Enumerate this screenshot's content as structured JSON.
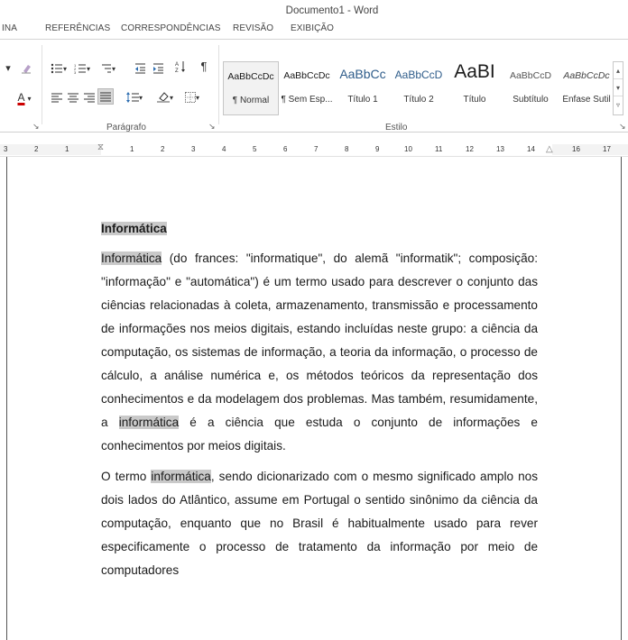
{
  "window": {
    "title": "Documento1 - Word"
  },
  "menu": {
    "tabs": [
      "ΙNA",
      "REFERÊNCIAS",
      "CORRESPONDÊNCIAS",
      "REVISÃO",
      "EXIBIÇÃO"
    ]
  },
  "ribbon": {
    "groups": {
      "paragraph": "Parágrafo",
      "styles": "Estilo"
    },
    "styles": [
      {
        "sample": "AaBbCcDc",
        "name": "¶ Normal",
        "selected": true
      },
      {
        "sample": "AaBbCcDc",
        "name": "¶ Sem Esp...",
        "selected": false
      },
      {
        "sample": "AaBbCc",
        "name": "Título 1",
        "selected": false
      },
      {
        "sample": "AaBbCcD",
        "name": "Título 2",
        "selected": false
      },
      {
        "sample": "AaBI",
        "name": "Título",
        "selected": false
      },
      {
        "sample": "AaBbCcD",
        "name": "Subtítulo",
        "selected": false
      },
      {
        "sample": "AaBbCcDc",
        "name": "Ênfase Sutil",
        "selected": false
      }
    ]
  },
  "ruler": {
    "numbers_left": [
      "3",
      "2",
      "1"
    ],
    "numbers_right": [
      "1",
      "2",
      "3",
      "4",
      "5",
      "6",
      "7",
      "8",
      "9",
      "10",
      "11",
      "12",
      "13",
      "14",
      "16",
      "17"
    ]
  },
  "document": {
    "heading": "Informática",
    "p1": {
      "hl1": "Informática",
      "text1": " (do frances: \"informatique\", do alemã \"informatik\"; composição: \"informação\" e \"automática\") é um termo usado para descrever o conjunto das ciências relacionadas à coleta, armazenamento, transmissão e processamento de informações nos meios digitais, estando incluídas neste grupo: a ciência da computação, os sistemas de informação, a teoria da informação, o processo de cálculo, a análise numérica e, os métodos teóricos da representação dos conhecimentos e da modelagem dos problemas. Mas também, resumidamente, a ",
      "hl2": "informática",
      "text2": " é a ciência que estuda o conjunto de informações e conhecimentos por meios digitais."
    },
    "p2": {
      "text1": "O termo ",
      "hl1": "informática",
      "text2": ", sendo dicionarizado com o mesmo significado amplo nos dois lados do Atlântico, assume em Portugal o sentido sinônimo da ciência da computação, enquanto que no Brasil é habitualmente usado para rever especificamente o processo de tratamento da informação por meio de computadores"
    }
  },
  "colors": {
    "highlight": "#c9c9c9",
    "ribbon_border": "#d0d0d0"
  }
}
